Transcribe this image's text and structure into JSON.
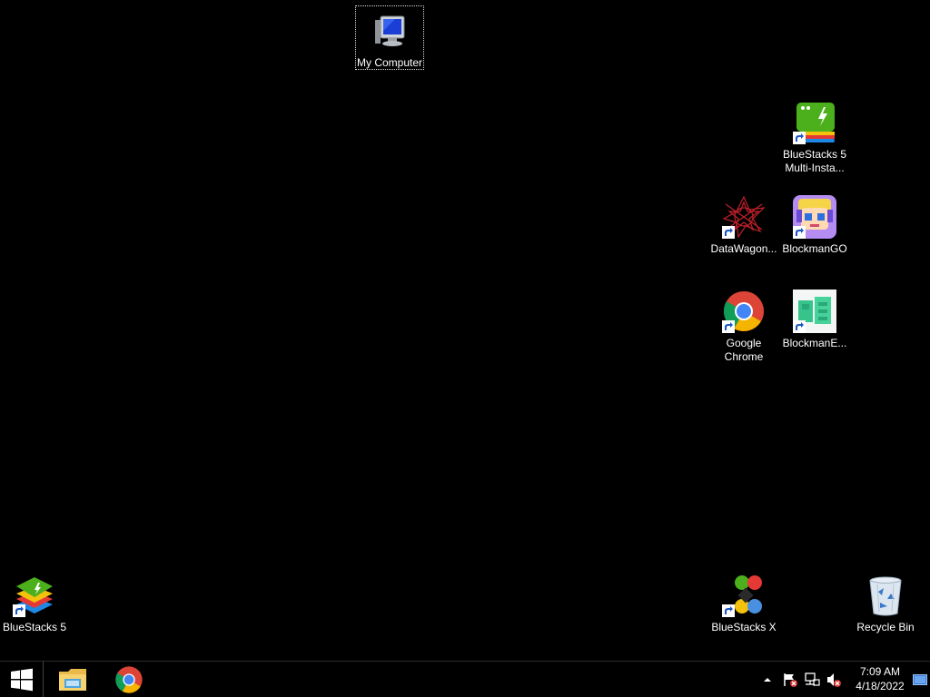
{
  "desktop": {
    "icons": {
      "my_computer": {
        "label": "My Computer",
        "icon": "monitor-icon"
      },
      "bluestacks_multi": {
        "label": "BlueStacks 5 Multi-Insta...",
        "icon": "bluestacks-multi-icon"
      },
      "datawagon": {
        "label": "DataWagon...",
        "icon": "datawagon-icon"
      },
      "blockmango": {
        "label": "BlockmanGO",
        "icon": "blockmango-icon"
      },
      "google_chrome": {
        "label": "Google Chrome",
        "icon": "chrome-icon"
      },
      "blockmane": {
        "label": "BlockmanE...",
        "icon": "blockman-editor-icon"
      },
      "bluestacks5": {
        "label": "BlueStacks 5",
        "icon": "bluestacks-icon"
      },
      "bluestacks_x": {
        "label": "BlueStacks X",
        "icon": "bluestacks-x-icon"
      },
      "recycle_bin": {
        "label": "Recycle Bin",
        "icon": "recycle-bin-icon"
      }
    }
  },
  "taskbar": {
    "start": {
      "icon": "windows-logo-icon"
    },
    "pinned": [
      {
        "name": "File Explorer",
        "icon": "folder-icon"
      },
      {
        "name": "Google Chrome",
        "icon": "chrome-icon"
      }
    ],
    "tray": {
      "icons": [
        "chevron-up-icon",
        "action-center-flag-icon",
        "network-icon",
        "volume-muted-icon"
      ],
      "time": "7:09 AM",
      "date": "4/18/2022"
    }
  },
  "colors": {
    "desktop_bg": "#000000",
    "taskbar_bg": "#000000",
    "chrome_red": "#DB4437",
    "chrome_yellow": "#F4B400",
    "chrome_green": "#0F9D58",
    "chrome_blue": "#4285F4"
  }
}
